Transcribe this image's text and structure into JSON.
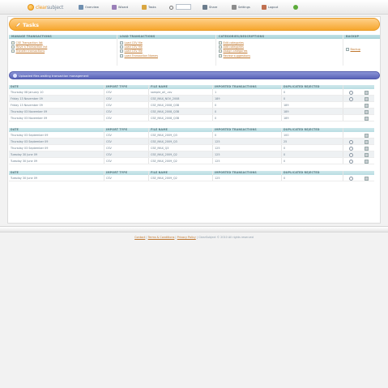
{
  "app": {
    "logo_prefix": "clear",
    "logo_suffix": "subject"
  },
  "nav": {
    "items": [
      {
        "label": "Overview"
      },
      {
        "label": "Wizard"
      },
      {
        "label": "Tasks"
      },
      {
        "label": "Share"
      },
      {
        "label": "Settings"
      },
      {
        "label": "Logout"
      }
    ],
    "search_value": ""
  },
  "tasks": {
    "title": "Tasks"
  },
  "sections": [
    {
      "heading": "Manage Transactions",
      "links": [
        "CSE Transaction list",
        "Move a Transaction list",
        "Transfer transactions"
      ]
    },
    {
      "heading": "Load Transactions",
      "links": [
        "Load CSV file",
        "Load CSV file",
        "Load CSV file",
        "Load Transaction Names"
      ]
    },
    {
      "heading": "Categories/Descriptions",
      "links": [
        "Edit categories",
        "Add categories",
        "Assign categories",
        "Review suggestions"
      ]
    },
    {
      "heading": "Backup",
      "links": [
        "Backup"
      ]
    }
  ],
  "uploaded": {
    "title": "Uploaded files waiting transaction management"
  },
  "tables": [
    {
      "columns": [
        "Date",
        "Import Type",
        "File Name",
        "Imported Transactions",
        "Duplicated Rejected"
      ],
      "rows": [
        [
          "Thursday 08 January 10",
          "CSV",
          "sample_all_.csv",
          "1",
          "0"
        ],
        [
          "Friday 13 November 09",
          "CSV",
          "CSE_MAX_NOV_2008",
          "189",
          "0"
        ],
        [
          "Friday 13 November 09",
          "CSV",
          "CSE_MAX_2008_Q3B",
          "0",
          "189"
        ],
        [
          "Thursday 03 November 09",
          "CSV",
          "CSE_MAX_2008_Q3B",
          "0",
          "189"
        ],
        [
          "Thursday 03 November 09",
          "CSV",
          "CSE_MAX_2008_Q3B",
          "0",
          "189"
        ]
      ]
    },
    {
      "columns": [
        "Date",
        "Import Type",
        "File Name",
        "Imported Transactions",
        "Duplicated Rejected"
      ],
      "rows": [
        [
          "Thursday 03 September 09",
          "CSV",
          "CSE_MAX_2009_Q3",
          "0",
          "100"
        ],
        [
          "Thursday 03 September 09",
          "CSV",
          "CSE_MAX_2009_Q3",
          "125",
          "25"
        ],
        [
          "Thursday 03 September 09",
          "CSV",
          "CSE_MAX_Q3",
          "125",
          "0"
        ],
        [
          "Tuesday 30 June 09",
          "CSV",
          "CSE_MAX_2009_Q2",
          "125",
          "0"
        ],
        [
          "Tuesday 30 June 09",
          "CSV",
          "CSE_MAX_2009_Q2",
          "125",
          "0"
        ]
      ]
    },
    {
      "columns": [
        "Date",
        "Import Type",
        "File Name",
        "Imported Transactions",
        "Duplicated Rejected"
      ],
      "rows": [
        [
          "Tuesday 30 June 09",
          "CSV",
          "CSE_MAX_2009_Q2",
          "125",
          "0"
        ]
      ]
    }
  ],
  "footer": {
    "links": [
      "Contact",
      "Terms & Conditions",
      "Privacy Policy"
    ],
    "copyright": "ClearSubject © 2010 All rights reserved"
  }
}
